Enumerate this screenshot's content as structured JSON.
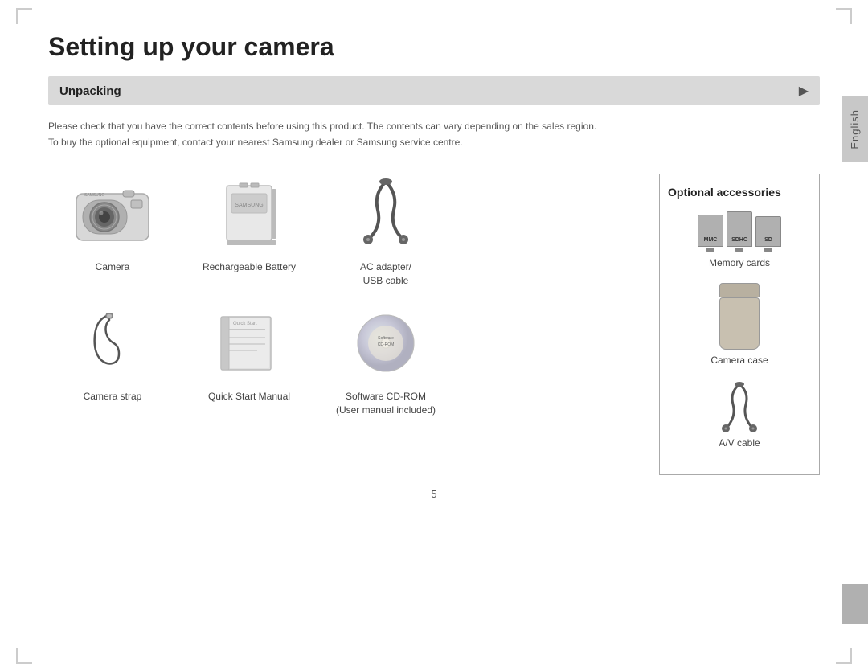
{
  "page": {
    "title": "Setting up your camera",
    "section": {
      "label": "Unpacking",
      "arrow": "▶"
    },
    "description": "Please check that you have the correct contents before using this product. The contents can vary depending on the sales region.\nTo buy the optional equipment, contact your nearest Samsung dealer or Samsung service centre.",
    "items_row1": [
      {
        "label": "Camera",
        "icon": "camera"
      },
      {
        "label": "Rechargeable Battery",
        "icon": "battery"
      },
      {
        "label": "AC adapter/\nUSB cable",
        "icon": "ac-adapter"
      }
    ],
    "items_row2": [
      {
        "label": "Camera strap",
        "icon": "strap"
      },
      {
        "label": "Quick Start Manual",
        "icon": "manual"
      },
      {
        "label": "Software CD-ROM\n(User manual included)",
        "icon": "cdrom"
      }
    ],
    "optional": {
      "title": "Optional accessories",
      "items": [
        {
          "label": "Memory cards",
          "icon": "memory-cards"
        },
        {
          "label": "Camera case",
          "icon": "camera-case"
        },
        {
          "label": "A/V cable",
          "icon": "av-cable"
        }
      ]
    },
    "page_number": "5",
    "side_label": "English",
    "memory_card_types": [
      "MMC",
      "SDHC",
      "SD"
    ]
  }
}
